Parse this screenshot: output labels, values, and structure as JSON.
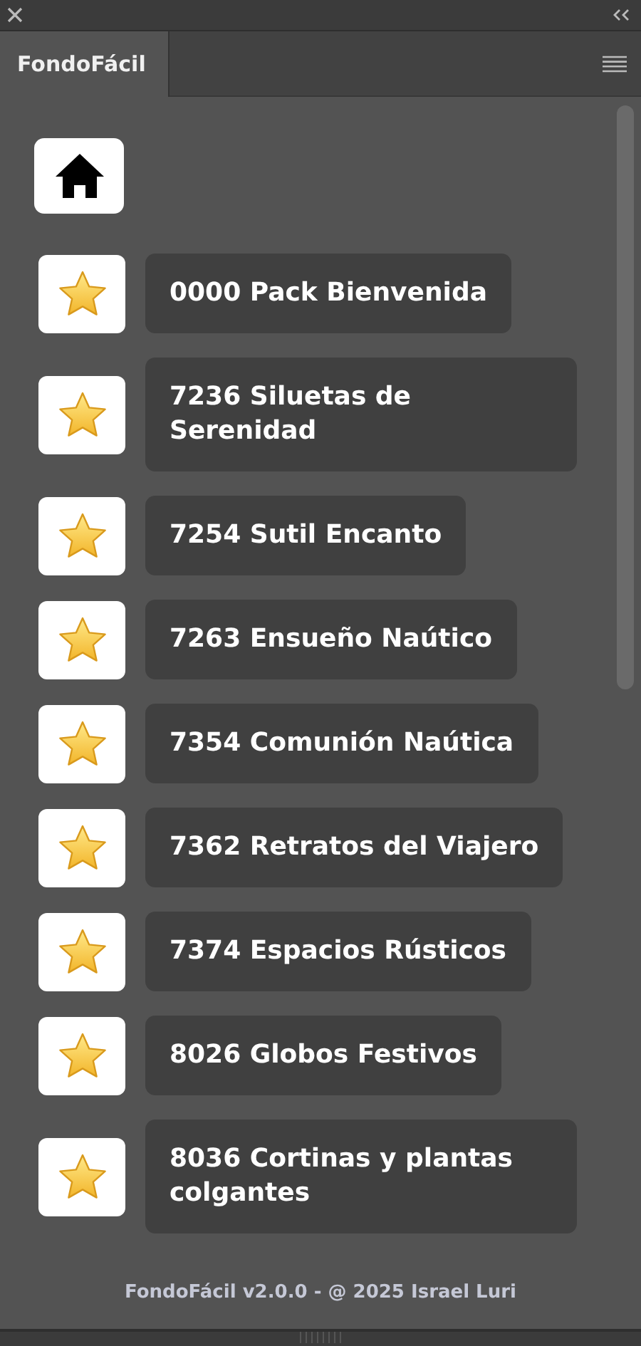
{
  "panel": {
    "tab": {
      "label": "FondoFácil",
      "selected": true
    }
  },
  "packs": [
    {
      "label": "0000 Pack Bienvenida"
    },
    {
      "label": "7236 Siluetas de Serenidad"
    },
    {
      "label": "7254 Sutil Encanto"
    },
    {
      "label": "7263 Ensueño Naútico"
    },
    {
      "label": "7354 Comunión Naútica"
    },
    {
      "label": "7362 Retratos del Viajero"
    },
    {
      "label": "7374 Espacios Rústicos"
    },
    {
      "label": "8026 Globos Festivos"
    },
    {
      "label": "8036 Cortinas y plantas colgantes"
    }
  ],
  "footer": "FondoFácil v2.0.0 - @ 2025 Israel Luri"
}
